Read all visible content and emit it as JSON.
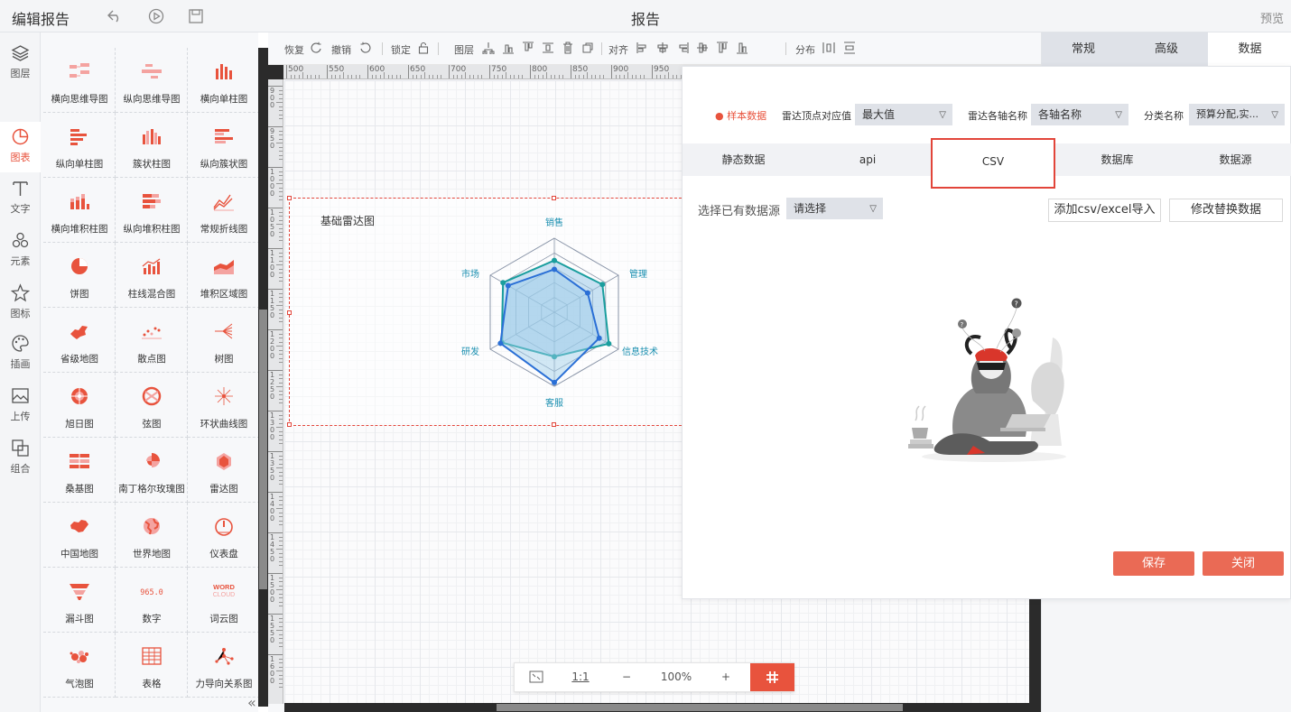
{
  "topbar": {
    "title": "编辑报告",
    "center_title": "报告",
    "preview": "预览"
  },
  "left_nav": [
    {
      "label": "图层",
      "icon": "layers-icon"
    },
    {
      "label": "图表",
      "icon": "chart-pie-icon",
      "active": true
    },
    {
      "label": "文字",
      "icon": "text-icon"
    },
    {
      "label": "元素",
      "icon": "shapes-icon"
    },
    {
      "label": "图标",
      "icon": "star-icon"
    },
    {
      "label": "插画",
      "icon": "palette-icon"
    },
    {
      "label": "上传",
      "icon": "upload-image-icon"
    },
    {
      "label": "组合",
      "icon": "group-icon"
    }
  ],
  "palette": [
    {
      "label": "横向思维导图",
      "icon": "mindmap-h-icon"
    },
    {
      "label": "纵向思维导图",
      "icon": "mindmap-v-icon"
    },
    {
      "label": "横向单柱图",
      "icon": "bar-h-icon"
    },
    {
      "label": "纵向单柱图",
      "icon": "bar-v-icon"
    },
    {
      "label": "簇状柱图",
      "icon": "cluster-bar-icon"
    },
    {
      "label": "纵向簇状图",
      "icon": "cluster-bar-v-icon"
    },
    {
      "label": "横向堆积柱图",
      "icon": "stacked-bar-h-icon"
    },
    {
      "label": "纵向堆积柱图",
      "icon": "stacked-bar-v-icon"
    },
    {
      "label": "常规折线图",
      "icon": "line-chart-icon"
    },
    {
      "label": "饼图",
      "icon": "pie-icon"
    },
    {
      "label": "柱线混合图",
      "icon": "bar-line-icon"
    },
    {
      "label": "堆积区域图",
      "icon": "area-icon"
    },
    {
      "label": "省级地图",
      "icon": "province-map-icon"
    },
    {
      "label": "散点图",
      "icon": "scatter-icon"
    },
    {
      "label": "树图",
      "icon": "tree-icon"
    },
    {
      "label": "旭日图",
      "icon": "sunburst-icon"
    },
    {
      "label": "弦图",
      "icon": "chord-icon"
    },
    {
      "label": "环状曲线图",
      "icon": "radial-curve-icon"
    },
    {
      "label": "桑基图",
      "icon": "sankey-icon"
    },
    {
      "label": "南丁格尔玫瑰图",
      "icon": "rose-icon"
    },
    {
      "label": "雷达图",
      "icon": "radar-icon"
    },
    {
      "label": "中国地图",
      "icon": "china-map-icon"
    },
    {
      "label": "世界地图",
      "icon": "globe-icon"
    },
    {
      "label": "仪表盘",
      "icon": "gauge-icon"
    },
    {
      "label": "漏斗图",
      "icon": "funnel-icon"
    },
    {
      "label": "数字",
      "icon": "number-icon",
      "glyph": "(965.0)"
    },
    {
      "label": "词云图",
      "icon": "wordcloud-icon",
      "glyph_top": "WORD",
      "glyph_bottom": "CLOUD"
    },
    {
      "label": "气泡图",
      "icon": "bubble-icon"
    },
    {
      "label": "表格",
      "icon": "table-icon"
    },
    {
      "label": "力导向关系图",
      "icon": "force-graph-icon"
    }
  ],
  "canvas_toolbar": {
    "redo": "恢复",
    "undo": "撤销",
    "lock": "锁定",
    "layer": "图层",
    "align": "对齐",
    "distribute": "分布"
  },
  "ruler": {
    "h_ticks": [
      "500",
      "550",
      "600",
      "650",
      "700",
      "750",
      "800",
      "850",
      "900",
      "950"
    ],
    "v_ticks": [
      "900",
      "950",
      "1000",
      "1050",
      "1100",
      "1150",
      "1200",
      "1250",
      "1300",
      "1350",
      "1400",
      "1450",
      "1500",
      "1550",
      "1600"
    ]
  },
  "widget": {
    "title": "基础雷达图",
    "chart_data": {
      "type": "radar",
      "indicators": [
        "销售",
        "管理",
        "信息技术",
        "客服",
        "研发",
        "市场"
      ],
      "max": 100,
      "series": [
        {
          "values": [
            70,
            75,
            85,
            60,
            82,
            80
          ],
          "color": "#1a9e9e"
        },
        {
          "values": [
            58,
            52,
            70,
            95,
            84,
            72
          ],
          "color": "#2a6fd6"
        }
      ],
      "fill_color": "#9ccbe8",
      "title": "基础雷达图"
    }
  },
  "zoombar": {
    "fit": "fit-screen-icon",
    "one_to_one": "1:1",
    "zoom_out": "−",
    "zoom": "100%",
    "zoom_in": "+",
    "grid": "grid-toggle-icon"
  },
  "right_panel": {
    "tabs": [
      "常规",
      "高级",
      "数据"
    ],
    "active": "数据"
  },
  "dialog": {
    "sample_data": "样本数据",
    "vertex_label": "雷达顶点对应值",
    "vertex_value": "最大值",
    "axis_label": "雷达各轴名称",
    "axis_value": "各轴名称",
    "category_label": "分类名称",
    "category_value": "预算分配,实...",
    "tabs": [
      "静态数据",
      "api",
      "CSV",
      "数据库",
      "数据源"
    ],
    "active_tab": "CSV",
    "datasource_label": "选择已有数据源",
    "datasource_placeholder": "请选择",
    "import_btn": "添加csv/excel导入",
    "replace_btn": "修改替换数据",
    "save": "保存",
    "close": "关闭"
  }
}
